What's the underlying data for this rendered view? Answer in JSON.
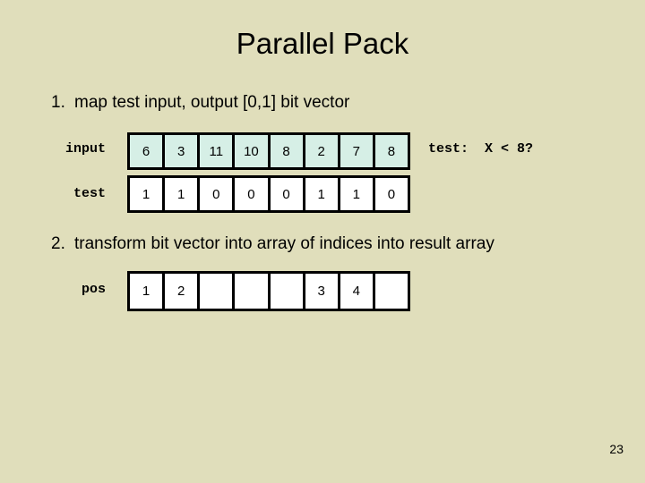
{
  "slide": {
    "title": "Parallel Pack",
    "page_number": "23",
    "background_color": "#e0debb",
    "accent_cell_color": "#d6efe6"
  },
  "bullets": [
    {
      "number": "1.",
      "text": "map test input, output [0,1] bit vector"
    },
    {
      "number": "2.",
      "text": "transform bit vector into array of indices into result array"
    }
  ],
  "annotation": {
    "label": "test:",
    "expression": "X < 8?"
  },
  "arrays": [
    {
      "label": "input",
      "tinted": true,
      "cells": [
        "6",
        "3",
        "11",
        "10",
        "8",
        "2",
        "7",
        "8"
      ]
    },
    {
      "label": "test",
      "tinted": false,
      "cells": [
        "1",
        "1",
        "0",
        "0",
        "0",
        "1",
        "1",
        "0"
      ]
    },
    {
      "label": "pos",
      "tinted": false,
      "cells": [
        "1",
        "2",
        "",
        "",
        "",
        "3",
        "4",
        ""
      ]
    }
  ]
}
